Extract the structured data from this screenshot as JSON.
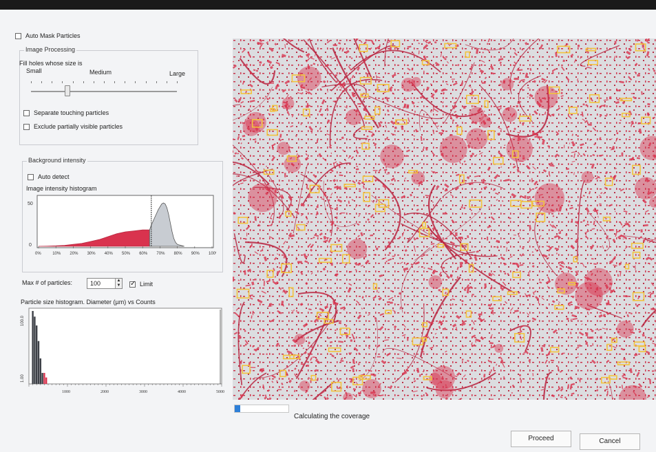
{
  "auto_mask": {
    "label": "Auto Mask Particles",
    "checked": false
  },
  "image_processing": {
    "title": "Image Processing",
    "fill_holes_label": "Fill holes whose size is",
    "slider_small": "Small",
    "slider_medium": "Medium",
    "slider_large": "Large",
    "slider_level": 0.25,
    "separate_touching": {
      "label": "Separate touching particles",
      "checked": false
    },
    "exclude_partial": {
      "label": "Exclude partially visible particles",
      "checked": false
    }
  },
  "background": {
    "title": "Background intensity",
    "auto_detect": {
      "label": "Auto detect",
      "checked": false
    },
    "histogram_label": "Image intensity histogram",
    "y_max_label": "50",
    "y_min_label": "0"
  },
  "particles": {
    "max_label": "Max # of particles:",
    "max_value": "100",
    "limit": {
      "label": "Limit",
      "checked": true
    },
    "size_hist_label": "Particle size histogram. Diameter (µm) vs Counts",
    "y_top_label": "100.0",
    "y_bottom_label": "1.00"
  },
  "chart_data": [
    {
      "type": "area",
      "x_tick_labels": [
        "0%",
        "10%",
        "20%",
        "30%",
        "40%",
        "50%",
        "60%",
        "70%",
        "80%",
        "90%",
        "100%"
      ],
      "xlim": [
        0,
        100
      ],
      "ylim": [
        0,
        50
      ],
      "threshold": 65,
      "series": [
        {
          "x": [
            0,
            5,
            10,
            15,
            20,
            25,
            30,
            35,
            40,
            45,
            50,
            55,
            60,
            64
          ],
          "values": [
            0,
            0.2,
            0.5,
            1,
            2,
            3,
            5,
            7,
            10,
            13,
            15,
            16,
            17,
            17
          ]
        },
        {
          "x": [
            64,
            65,
            67,
            69,
            71,
            72,
            73,
            74,
            75,
            76,
            77,
            78,
            79,
            80,
            82,
            84
          ],
          "values": [
            17,
            22,
            30,
            38,
            44,
            45,
            44,
            40,
            33,
            24,
            15,
            8,
            4,
            2,
            1,
            0
          ]
        }
      ]
    },
    {
      "type": "bar",
      "x_tick_labels": [
        "1000",
        "2000",
        "3000",
        "4000",
        "5000"
      ],
      "xlim": [
        0,
        5000
      ],
      "ylim": [
        1,
        100
      ],
      "series": [
        {
          "x": [
            100,
            150,
            200,
            250,
            300,
            350
          ],
          "values": [
            100,
            70,
            40,
            15,
            5,
            2
          ]
        },
        {
          "x": [
            400,
            450
          ],
          "values": [
            2,
            1.5
          ]
        }
      ]
    }
  ],
  "status": {
    "progress": 0.1,
    "label": "Calculating the coverage"
  },
  "buttons": {
    "proceed": "Proceed",
    "cancel": "Cancel"
  },
  "colors": {
    "particle": "#d9334e",
    "highlight": "#f2c33d",
    "progress": "#2d7fd8"
  }
}
